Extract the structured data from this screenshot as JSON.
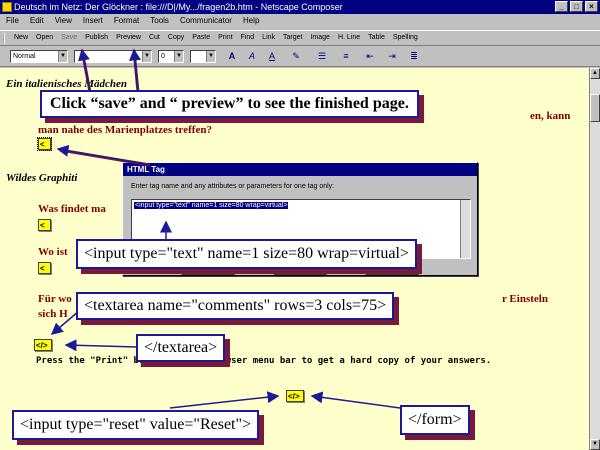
{
  "window": {
    "title": "Deutsch im Netz: Der Glöckner  : file:///D|/My.../fragen2b.htm - Netscape Composer",
    "buttons": {
      "minimize": "_",
      "maximize": "□",
      "close": "×"
    }
  },
  "menu": [
    "File",
    "Edit",
    "View",
    "Insert",
    "Format",
    "Tools",
    "Communicator",
    "Help"
  ],
  "toolbar": [
    "New",
    "Open",
    "Save",
    "Publish",
    "Preview",
    "Cut",
    "Copy",
    "Paste",
    "Print",
    "Find",
    "Link",
    "Target",
    "Image",
    "H. Line",
    "Table",
    "Spelling"
  ],
  "format_bar": {
    "paragraph_style": "Normal",
    "font_size": "0"
  },
  "document": {
    "heading1": "Ein italienisches Mädchen",
    "question1_end": "man nahe des Marienplatzes treffen?",
    "question1_tail": "en, kann",
    "heading2": "Wildes Graphiti",
    "q2": "Was findet ma",
    "q3": "Wo ist",
    "q4a": "Für wo",
    "q4a_tail": "r Einsteln",
    "q4b": "sich H",
    "press": "Press the \"Print\" button in the browser menu bar to get a hard copy of your answers."
  },
  "dialog": {
    "title": "HTML Tag",
    "label": "Enter tag name and any attributes or parameters for one tag only:",
    "content": "<input type=\"text\" name=1 size=80 wrap=virtual>"
  },
  "callouts": {
    "instruction": "Click “save” and “ preview” to see the finished page.",
    "input_tag": "<input type=\"text\" name=1 size=80 wrap=virtual>",
    "textarea_tag": "<textarea name=\"comments\" rows=3 cols=75>",
    "textarea_close": "</textarea>",
    "reset_tag": "<input type=\"reset\" value=\"Reset\">",
    "form_close": "</form>"
  },
  "colors": {
    "document_bg": "#ffffcc",
    "question_text": "#800000",
    "callout_border": "#1a1a99",
    "callout_shadow": "#7a1a3a",
    "titlebar": "#000080"
  }
}
